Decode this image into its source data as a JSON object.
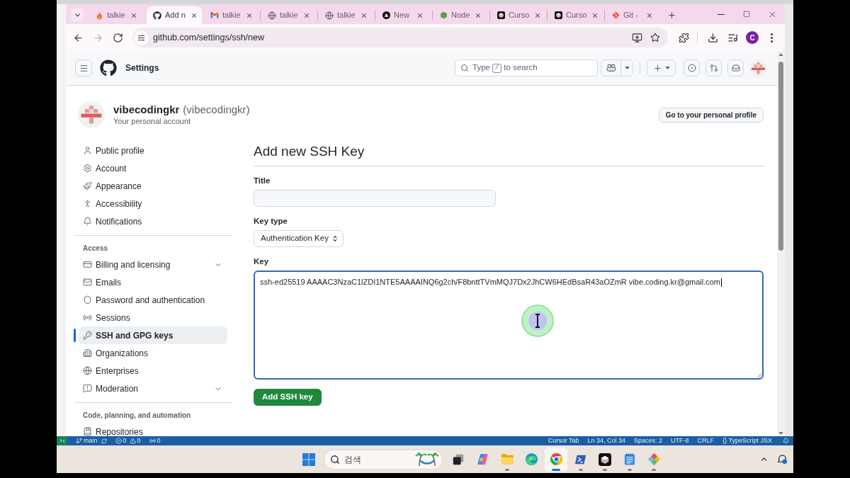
{
  "browser": {
    "tabs": [
      {
        "label": "talkie",
        "selected": false
      },
      {
        "label": "Add n",
        "selected": true
      },
      {
        "label": "talkie",
        "selected": false
      },
      {
        "label": "talkie",
        "selected": false
      },
      {
        "label": "talkie",
        "selected": false
      },
      {
        "label": "New",
        "selected": false
      },
      {
        "label": "Node",
        "selected": false
      },
      {
        "label": "Curso",
        "selected": false
      },
      {
        "label": "Curso",
        "selected": false
      },
      {
        "label": "Git -",
        "selected": false
      }
    ],
    "nav_buttons": [
      {
        "disabled": false
      },
      {
        "disabled": true
      },
      {
        "disabled": false
      }
    ],
    "address": "github.com/settings/ssh/new",
    "profile_initial": "C"
  },
  "github_header": {
    "title": "Settings",
    "search": {
      "before": "Type",
      "key": "/",
      "after": "to search"
    }
  },
  "account": {
    "name": "vibecodingkr",
    "login": "(vibecodingkr)",
    "subtitle": "Your personal account",
    "profile_button": "Go to your personal profile"
  },
  "sidebar": {
    "sections": [
      {
        "items": [
          {
            "label": "Public profile",
            "kind": "link",
            "selected": false
          },
          {
            "label": "Account",
            "kind": "link",
            "selected": false
          },
          {
            "label": "Appearance",
            "kind": "link",
            "selected": false
          },
          {
            "label": "Accessibility",
            "kind": "link",
            "selected": false
          },
          {
            "label": "Notifications",
            "kind": "link",
            "selected": false
          }
        ]
      },
      {
        "heading": "Access",
        "items": [
          {
            "label": "Billing and licensing",
            "kind": "group",
            "expanded": false,
            "selected": false
          },
          {
            "label": "Emails",
            "kind": "link",
            "selected": false
          },
          {
            "label": "Password and authentication",
            "kind": "link",
            "selected": false
          },
          {
            "label": "Sessions",
            "kind": "link",
            "selected": false
          },
          {
            "label": "SSH and GPG keys",
            "kind": "link",
            "selected": true
          },
          {
            "label": "Organizations",
            "kind": "link",
            "selected": false
          },
          {
            "label": "Enterprises",
            "kind": "link",
            "selected": false
          },
          {
            "label": "Moderation",
            "kind": "group",
            "expanded": false,
            "selected": false
          }
        ]
      },
      {
        "heading": "Code, planning, and automation",
        "items": [
          {
            "label": "Repositories",
            "kind": "link",
            "selected": false
          }
        ]
      }
    ]
  },
  "form": {
    "heading": "Add new SSH Key",
    "fields": [
      {
        "label": "Title",
        "kind": "text",
        "focused": false
      },
      {
        "label": "Key type",
        "kind": "select",
        "value": "Authentication Key",
        "focused": false
      },
      {
        "label": "Key",
        "kind": "textarea",
        "value": "ssh-ed25519 AAAAC3NzaC1lZDI1NTE5AAAAINQ6g2ch/F8bnttTVmMQJ7Dx2JhCW6HEdBsaR43aOZmR vibe.coding.kr@gmail.com",
        "focused": true
      }
    ],
    "submit": "Add SSH key"
  },
  "editor_status_bar": {
    "branch": "main",
    "problems": {
      "errors": "0",
      "warnings": "0"
    },
    "ports": "0",
    "items": [
      "Cursor Tab",
      "Ln 34, Col 34",
      "Spaces: 2",
      "UTF-8",
      "CRLF",
      "{} TypeScript JSX"
    ]
  },
  "taskbar": {
    "search_placeholder": "검색",
    "apps": [
      {
        "running": false,
        "selected": false
      },
      {
        "running": false,
        "selected": false
      },
      {
        "running": true,
        "selected": false
      },
      {
        "running": false,
        "selected": false
      },
      {
        "running": true,
        "selected": true
      },
      {
        "running": true,
        "selected": false
      },
      {
        "running": true,
        "selected": false
      },
      {
        "running": true,
        "selected": false
      },
      {
        "running": true,
        "selected": false
      }
    ]
  }
}
